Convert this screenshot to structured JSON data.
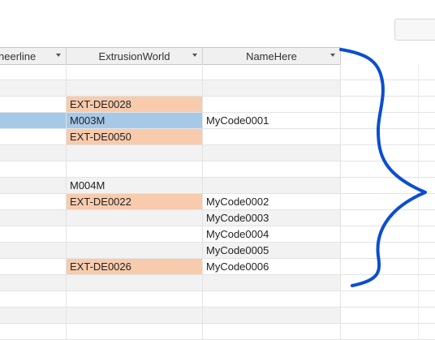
{
  "columns": [
    {
      "label": "heerline"
    },
    {
      "label": "ExtrusionWorld"
    },
    {
      "label": "NameHere"
    }
  ],
  "rows": [
    {
      "ext": "",
      "name": "",
      "hl": false
    },
    {
      "ext": "",
      "name": "",
      "hl": false
    },
    {
      "ext": "EXT-DE0028",
      "name": "",
      "hl": true
    },
    {
      "ext": "M003M",
      "name": "MyCode0001",
      "hl": false,
      "selected": true
    },
    {
      "ext": "EXT-DE0050",
      "name": "",
      "hl": true
    },
    {
      "ext": "",
      "name": "",
      "hl": false
    },
    {
      "ext": "",
      "name": "",
      "hl": false
    },
    {
      "ext": "M004M",
      "name": "",
      "hl": false
    },
    {
      "ext": "EXT-DE0022",
      "name": "MyCode0002",
      "hl": true
    },
    {
      "ext": "",
      "name": "MyCode0003",
      "hl": false
    },
    {
      "ext": "",
      "name": "MyCode0004",
      "hl": false
    },
    {
      "ext": "",
      "name": "MyCode0005",
      "hl": false
    },
    {
      "ext": "EXT-DE0026",
      "name": "MyCode0006",
      "hl": true
    },
    {
      "ext": "",
      "name": "",
      "hl": false
    },
    {
      "ext": "",
      "name": "",
      "hl": false
    },
    {
      "ext": "",
      "name": "",
      "hl": false
    },
    {
      "ext": "",
      "name": "",
      "hl": false
    }
  ],
  "colors": {
    "highlight": "#f8cbad",
    "selection": "#a7c9e8",
    "annotation": "#0b4ed0"
  },
  "icons": {
    "header_dropdown": "chevron-down-icon",
    "annotation": "curly-brace-annotation"
  }
}
